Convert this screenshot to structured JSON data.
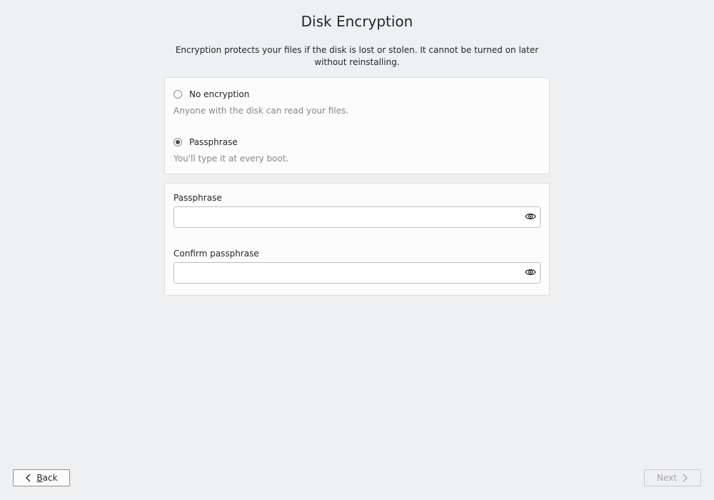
{
  "page": {
    "title": "Disk Encryption",
    "description": "Encryption protects your files if the disk is lost or stolen. It cannot be turned on later without reinstalling."
  },
  "options": [
    {
      "label": "No encryption",
      "hint": "Anyone with the disk can read your files.",
      "selected": false
    },
    {
      "label": "Passphrase",
      "hint": "You'll type it at every boot.",
      "selected": true
    }
  ],
  "fields": {
    "passphrase": {
      "label": "Passphrase",
      "value": "",
      "placeholder": ""
    },
    "confirm": {
      "label": "Confirm passphrase",
      "value": "",
      "placeholder": ""
    }
  },
  "footer": {
    "back_first": "B",
    "back_rest": "ack",
    "next_label": "Next"
  },
  "icons": {
    "reveal": "eye-icon",
    "back": "chevron-left-icon",
    "next": "chevron-right-icon"
  },
  "colors": {
    "background": "#eff0f1",
    "card": "#fcfcfc",
    "hint": "#7f8c8d",
    "disabled_text": "#a3a5a7"
  }
}
